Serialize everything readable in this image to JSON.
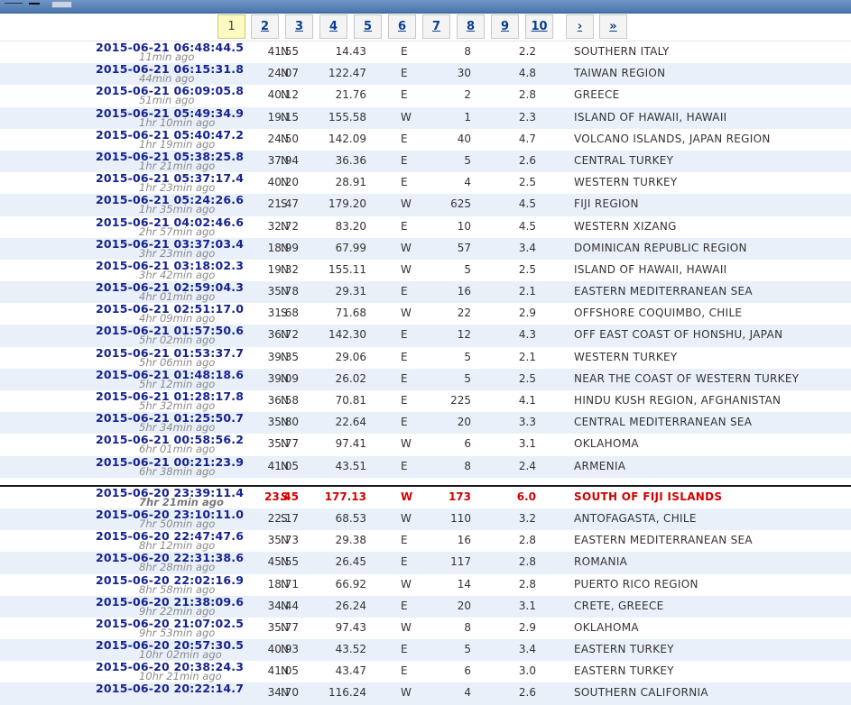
{
  "pager": {
    "pages": [
      "1",
      "2",
      "3",
      "4",
      "5",
      "6",
      "7",
      "8",
      "9",
      "10",
      "›",
      "»"
    ],
    "current": "1"
  },
  "rows": [
    {
      "dt": "2015-06-21   06:48:44.5",
      "ago": "11min ago",
      "lat": "41.55",
      "ns": "N",
      "lon": "14.43",
      "ew": "E",
      "depth": "8",
      "mag": "2.2",
      "region": "SOUTHERN ITALY"
    },
    {
      "dt": "2015-06-21   06:15:31.8",
      "ago": "44min ago",
      "lat": "24.07",
      "ns": "N",
      "lon": "122.47",
      "ew": "E",
      "depth": "30",
      "mag": "4.8",
      "region": "TAIWAN REGION"
    },
    {
      "dt": "2015-06-21   06:09:05.8",
      "ago": "51min ago",
      "lat": "40.12",
      "ns": "N",
      "lon": "21.76",
      "ew": "E",
      "depth": "2",
      "mag": "2.8",
      "region": "GREECE"
    },
    {
      "dt": "2015-06-21   05:49:34.9",
      "ago": "1hr 10min ago",
      "lat": "19.15",
      "ns": "N",
      "lon": "155.58",
      "ew": "W",
      "depth": "1",
      "mag": "2.3",
      "region": "ISLAND OF HAWAII, HAWAII"
    },
    {
      "dt": "2015-06-21   05:40:47.2",
      "ago": "1hr 19min ago",
      "lat": "24.50",
      "ns": "N",
      "lon": "142.09",
      "ew": "E",
      "depth": "40",
      "mag": "4.7",
      "region": "VOLCANO ISLANDS, JAPAN REGION"
    },
    {
      "dt": "2015-06-21   05:38:25.8",
      "ago": "1hr 21min ago",
      "lat": "37.94",
      "ns": "N",
      "lon": "36.36",
      "ew": "E",
      "depth": "5",
      "mag": "2.6",
      "region": "CENTRAL TURKEY"
    },
    {
      "dt": "2015-06-21   05:37:17.4",
      "ago": "1hr 23min ago",
      "lat": "40.20",
      "ns": "N",
      "lon": "28.91",
      "ew": "E",
      "depth": "4",
      "mag": "2.5",
      "region": "WESTERN TURKEY"
    },
    {
      "dt": "2015-06-21   05:24:26.6",
      "ago": "1hr 35min ago",
      "lat": "21.47",
      "ns": "S",
      "lon": "179.20",
      "ew": "W",
      "depth": "625",
      "mag": "4.5",
      "region": "FIJI REGION"
    },
    {
      "dt": "2015-06-21   04:02:46.6",
      "ago": "2hr 57min ago",
      "lat": "32.72",
      "ns": "N",
      "lon": "83.20",
      "ew": "E",
      "depth": "10",
      "mag": "4.5",
      "region": "WESTERN XIZANG"
    },
    {
      "dt": "2015-06-21   03:37:03.4",
      "ago": "3hr 23min ago",
      "lat": "18.99",
      "ns": "N",
      "lon": "67.99",
      "ew": "W",
      "depth": "57",
      "mag": "3.4",
      "region": "DOMINICAN REPUBLIC REGION"
    },
    {
      "dt": "2015-06-21   03:18:02.3",
      "ago": "3hr 42min ago",
      "lat": "19.32",
      "ns": "N",
      "lon": "155.11",
      "ew": "W",
      "depth": "5",
      "mag": "2.5",
      "region": "ISLAND OF HAWAII, HAWAII"
    },
    {
      "dt": "2015-06-21   02:59:04.3",
      "ago": "4hr 01min ago",
      "lat": "35.78",
      "ns": "N",
      "lon": "29.31",
      "ew": "E",
      "depth": "16",
      "mag": "2.1",
      "region": "EASTERN MEDITERRANEAN SEA"
    },
    {
      "dt": "2015-06-21   02:51:17.0",
      "ago": "4hr 09min ago",
      "lat": "31.68",
      "ns": "S",
      "lon": "71.68",
      "ew": "W",
      "depth": "22",
      "mag": "2.9",
      "region": "OFFSHORE COQUIMBO, CHILE"
    },
    {
      "dt": "2015-06-21   01:57:50.6",
      "ago": "5hr 02min ago",
      "lat": "36.72",
      "ns": "N",
      "lon": "142.30",
      "ew": "E",
      "depth": "12",
      "mag": "4.3",
      "region": "OFF EAST COAST OF HONSHU, JAPAN"
    },
    {
      "dt": "2015-06-21   01:53:37.7",
      "ago": "5hr 06min ago",
      "lat": "39.35",
      "ns": "N",
      "lon": "29.06",
      "ew": "E",
      "depth": "5",
      "mag": "2.1",
      "region": "WESTERN TURKEY"
    },
    {
      "dt": "2015-06-21   01:48:18.6",
      "ago": "5hr 12min ago",
      "lat": "39.09",
      "ns": "N",
      "lon": "26.02",
      "ew": "E",
      "depth": "5",
      "mag": "2.5",
      "region": "NEAR THE COAST OF WESTERN TURKEY"
    },
    {
      "dt": "2015-06-21   01:28:17.8",
      "ago": "5hr 32min ago",
      "lat": "36.58",
      "ns": "N",
      "lon": "70.81",
      "ew": "E",
      "depth": "225",
      "mag": "4.1",
      "region": "HINDU KUSH REGION, AFGHANISTAN"
    },
    {
      "dt": "2015-06-21   01:25:50.7",
      "ago": "5hr 34min ago",
      "lat": "35.80",
      "ns": "N",
      "lon": "22.64",
      "ew": "E",
      "depth": "20",
      "mag": "3.3",
      "region": "CENTRAL MEDITERRANEAN SEA"
    },
    {
      "dt": "2015-06-21   00:58:56.2",
      "ago": "6hr 01min ago",
      "lat": "35.77",
      "ns": "N",
      "lon": "97.41",
      "ew": "W",
      "depth": "6",
      "mag": "3.1",
      "region": "OKLAHOMA"
    },
    {
      "dt": "2015-06-21   00:21:23.9",
      "ago": "6hr 38min ago",
      "lat": "41.05",
      "ns": "N",
      "lon": "43.51",
      "ew": "E",
      "depth": "8",
      "mag": "2.4",
      "region": "ARMENIA"
    },
    {
      "dt": "2015-06-20   23:39:11.4",
      "ago": "7hr 21min ago",
      "lat": "23.45",
      "ns": "S",
      "lon": "177.13",
      "ew": "W",
      "depth": "173",
      "mag": "6.0",
      "region": "SOUTH OF FIJI ISLANDS",
      "highlight": true
    },
    {
      "dt": "2015-06-20   23:10:11.0",
      "ago": "7hr 50min ago",
      "lat": "22.17",
      "ns": "S",
      "lon": "68.53",
      "ew": "W",
      "depth": "110",
      "mag": "3.2",
      "region": "ANTOFAGASTA, CHILE"
    },
    {
      "dt": "2015-06-20   22:47:47.6",
      "ago": "8hr 12min ago",
      "lat": "35.73",
      "ns": "N",
      "lon": "29.38",
      "ew": "E",
      "depth": "16",
      "mag": "2.8",
      "region": "EASTERN MEDITERRANEAN SEA"
    },
    {
      "dt": "2015-06-20   22:31:38.6",
      "ago": "8hr 28min ago",
      "lat": "45.55",
      "ns": "N",
      "lon": "26.45",
      "ew": "E",
      "depth": "117",
      "mag": "2.8",
      "region": "ROMANIA"
    },
    {
      "dt": "2015-06-20   22:02:16.9",
      "ago": "8hr 58min ago",
      "lat": "18.71",
      "ns": "N",
      "lon": "66.92",
      "ew": "W",
      "depth": "14",
      "mag": "2.8",
      "region": "PUERTO RICO REGION"
    },
    {
      "dt": "2015-06-20   21:38:09.6",
      "ago": "9hr 22min ago",
      "lat": "34.44",
      "ns": "N",
      "lon": "26.24",
      "ew": "E",
      "depth": "20",
      "mag": "3.1",
      "region": "CRETE, GREECE"
    },
    {
      "dt": "2015-06-20   21:07:02.5",
      "ago": "9hr 53min ago",
      "lat": "35.77",
      "ns": "N",
      "lon": "97.43",
      "ew": "W",
      "depth": "8",
      "mag": "2.9",
      "region": "OKLAHOMA"
    },
    {
      "dt": "2015-06-20   20:57:30.5",
      "ago": "10hr 02min ago",
      "lat": "40.93",
      "ns": "N",
      "lon": "43.52",
      "ew": "E",
      "depth": "5",
      "mag": "3.4",
      "region": "EASTERN TURKEY"
    },
    {
      "dt": "2015-06-20   20:38:24.3",
      "ago": "10hr 21min ago",
      "lat": "41.05",
      "ns": "N",
      "lon": "43.47",
      "ew": "E",
      "depth": "6",
      "mag": "3.0",
      "region": "EASTERN TURKEY"
    },
    {
      "dt": "2015-06-20   20:22:14.7",
      "ago": "",
      "lat": "34.70",
      "ns": "N",
      "lon": "116.24",
      "ew": "W",
      "depth": "4",
      "mag": "2.6",
      "region": "SOUTHERN CALIFORNIA"
    }
  ]
}
